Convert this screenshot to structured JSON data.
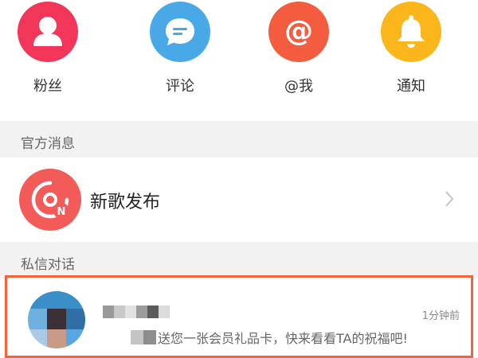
{
  "top_icons": [
    {
      "label": "粉丝",
      "icon": "person-icon",
      "color": "#f2365a"
    },
    {
      "label": "评论",
      "icon": "chat-bubble-icon",
      "color": "#48a9e6"
    },
    {
      "label": "@我",
      "icon": "at-sign-icon",
      "color": "#f35c3f"
    },
    {
      "label": "通知",
      "icon": "bell-icon",
      "color": "#fbb61c"
    }
  ],
  "official_section": {
    "header": "官方消息",
    "item": {
      "title": "新歌发布",
      "icon": "music-disc-logo-icon",
      "color": "#f25b57"
    }
  },
  "private_section": {
    "header": "私信对话",
    "message": {
      "time": "1分钟前",
      "preview": "送您一张会员礼品卡，快来看看TA的祝福吧!",
      "highlight_color": "#f0643e"
    }
  }
}
